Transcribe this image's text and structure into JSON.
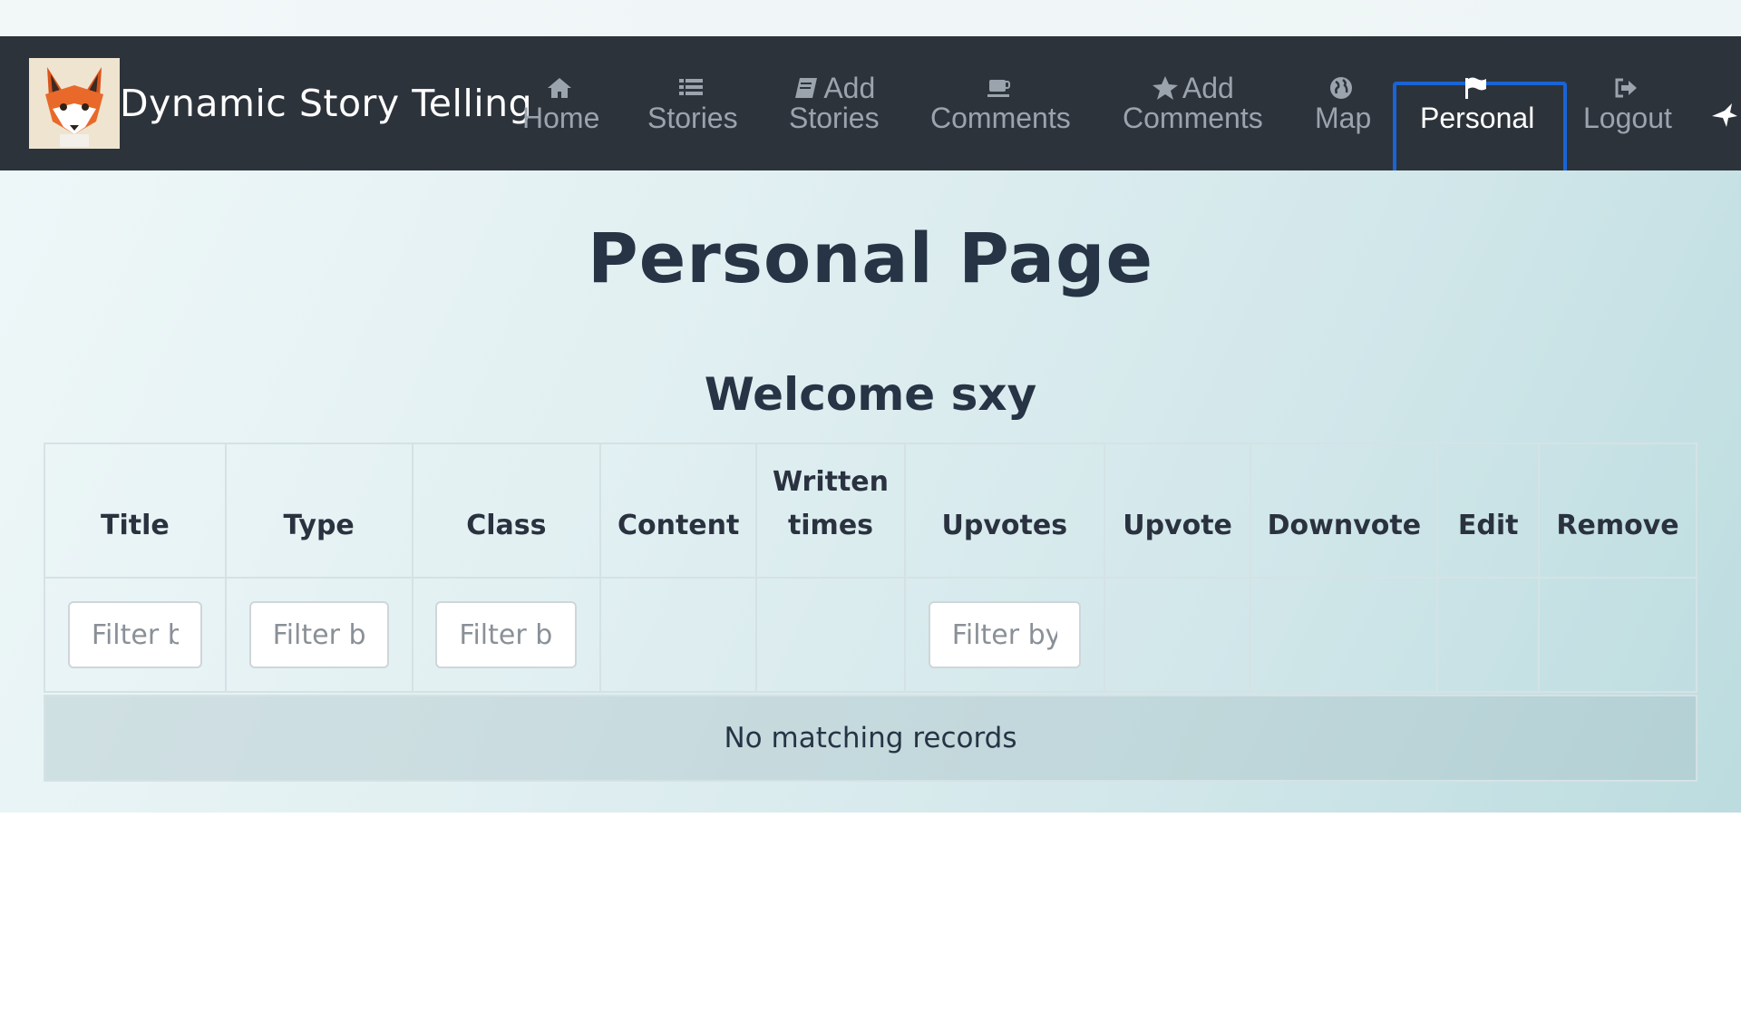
{
  "brand": {
    "title": "Dynamic Story Telling",
    "logo_icon": "fox-logo-icon"
  },
  "nav": [
    {
      "id": "home",
      "line1": "",
      "line2": "Home",
      "icon": "home-icon"
    },
    {
      "id": "stories",
      "line1": "",
      "line2": "Stories",
      "icon": "list-icon"
    },
    {
      "id": "add-stories",
      "line1": "Add",
      "line2": "Stories",
      "icon": "book-icon"
    },
    {
      "id": "comments",
      "line1": "",
      "line2": "Comments",
      "icon": "coffee-cup-icon"
    },
    {
      "id": "add-comments",
      "line1": "Add",
      "line2": "Comments",
      "icon": "star-icon"
    },
    {
      "id": "map",
      "line1": "",
      "line2": "Map",
      "icon": "globe-icon"
    },
    {
      "id": "personal",
      "line1": "",
      "line2": "Personal",
      "icon": "flag-icon",
      "active": true
    },
    {
      "id": "logout",
      "line1": "",
      "line2": "Logout",
      "icon": "sign-out-icon"
    }
  ],
  "page": {
    "title": "Personal Page",
    "welcome": "Welcome sxy"
  },
  "table": {
    "columns": [
      {
        "line1": "Title",
        "line2": "",
        "filter_placeholder": "Filter by Title"
      },
      {
        "line1": "Type",
        "line2": "",
        "filter_placeholder": "Filter by Type"
      },
      {
        "line1": "Class",
        "line2": "",
        "filter_placeholder": "Filter by Class"
      },
      {
        "line1": "Content",
        "line2": "",
        "filter_placeholder": ""
      },
      {
        "line1": "Written",
        "line2": "times",
        "filter_placeholder": ""
      },
      {
        "line1": "Upvotes",
        "line2": "",
        "filter_placeholder": "Filter by Upvotes"
      },
      {
        "line1": "Upvote",
        "line2": "",
        "filter_placeholder": ""
      },
      {
        "line1": "Downvote",
        "line2": "",
        "filter_placeholder": ""
      },
      {
        "line1": "Edit",
        "line2": "",
        "filter_placeholder": ""
      },
      {
        "line1": "Remove",
        "line2": "",
        "filter_placeholder": ""
      }
    ],
    "empty_message": "No matching records"
  },
  "colors": {
    "navbar_bg": "#2d333b",
    "active_nav_border": "#1a64d6",
    "heading_text": "#263445"
  }
}
